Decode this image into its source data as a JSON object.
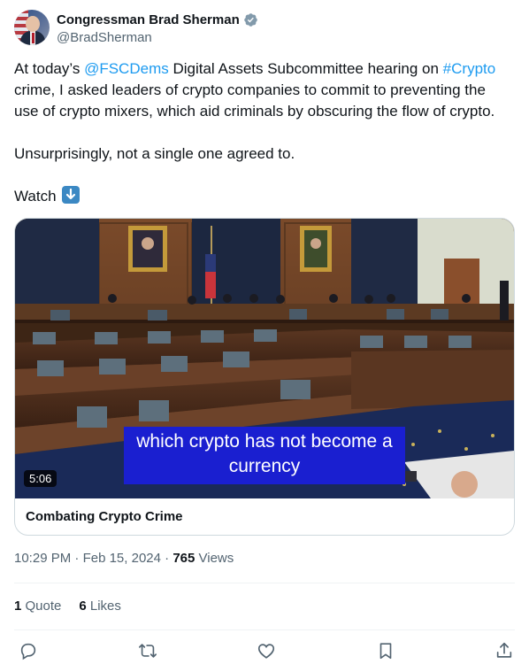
{
  "author": {
    "display_name": "Congressman Brad Sherman",
    "handle": "@BradSherman",
    "verified_icon": "verified-badge-icon",
    "avatar": "profile-photo"
  },
  "tweet": {
    "line1_pre": "At today’s ",
    "line1_mention": "@FSCDems",
    "line1_mid": " Digital Assets Subcommittee hearing on ",
    "line1_hashtag": "#Crypto",
    "line2": "crime, I asked leaders of crypto  companies to commit to preventing the",
    "line3": "use of crypto mixers, which aid criminals by obscuring the flow of crypto.",
    "line4": "Unsurprisingly, not a single one agreed to.",
    "line5": "Watch",
    "emoji": "down-arrow-emoji"
  },
  "media": {
    "duration": "5:06",
    "caption_line1": "which crypto has not become a",
    "caption_line2": "currency",
    "title": "Combating Crypto Crime"
  },
  "meta": {
    "time": "10:29 PM",
    "sep1": " · ",
    "date": "Feb 15, 2024",
    "sep2": " · ",
    "views_count": "765",
    "views_label": " Views"
  },
  "stats": {
    "quotes_count": "1",
    "quotes_label": " Quote",
    "likes_count": "6",
    "likes_label": " Likes"
  },
  "actions": [
    "reply-icon",
    "retweet-icon",
    "like-icon",
    "bookmark-icon",
    "share-icon"
  ],
  "colors": {
    "link": "#1d9bf0",
    "secondary_text": "#536471",
    "verified": "#829aab",
    "caption_bg": "#1a1fd0"
  }
}
